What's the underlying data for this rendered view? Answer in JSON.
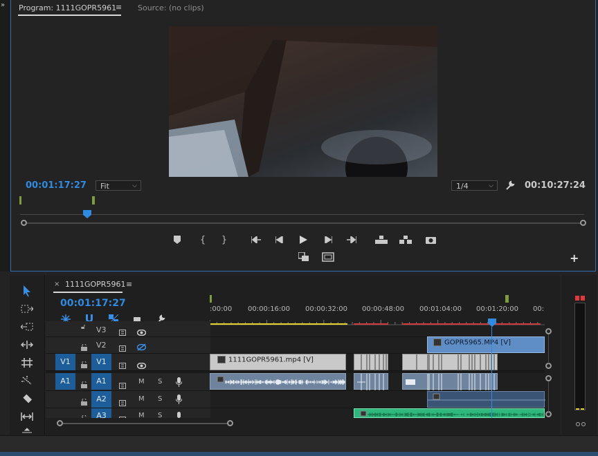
{
  "monitor": {
    "tabs": [
      {
        "label": "Program: 1111GOPR5961",
        "active": true
      },
      {
        "label": "Source: (no clips)",
        "active": false
      }
    ],
    "menu_icon": "≡",
    "current_time": "00:01:17:27",
    "fit_label": "Fit",
    "resolution_label": "1/4",
    "duration": "00:10:27:24",
    "playhead_fraction": 0.119,
    "controls": [
      "add-marker",
      "mark-in",
      "mark-out",
      "go-to-in",
      "step-back",
      "play",
      "step-forward",
      "go-to-out",
      "lift",
      "extract",
      "export-frame"
    ],
    "secondary_controls": [
      "insert-overwrite",
      "safe-margins"
    ],
    "add_button": "+"
  },
  "timeline": {
    "sequence_name": "1111GOPR5961",
    "close": "×",
    "menu_icon": "≡",
    "current_time": "00:01:17:27",
    "ruler_labels": [
      ":00:00",
      "00:00:16:00",
      "00:00:32:00",
      "00:00:48:00",
      "00:01:04:00",
      "00:01:20:00",
      "00:"
    ],
    "tracks": [
      {
        "name": "V3",
        "source": "",
        "target": "V3",
        "kind": "video"
      },
      {
        "name": "V2",
        "source": "",
        "target": "V2",
        "kind": "video"
      },
      {
        "name": "V1",
        "source": "V1",
        "target": "V1",
        "kind": "video"
      },
      {
        "name": "A1",
        "source": "A1",
        "target": "A1",
        "kind": "audio",
        "mute": "M",
        "solo": "S"
      },
      {
        "name": "A2",
        "source": "",
        "target": "A2",
        "kind": "audio",
        "mute": "M",
        "solo": "S"
      },
      {
        "name": "A3",
        "source": "",
        "target": "A3",
        "kind": "audio",
        "mute": "M",
        "solo": "S"
      }
    ],
    "clips": {
      "v2": "GOPR5965.MP4 [V]",
      "v1": "1111GOPR5961.mp4 [V]"
    }
  },
  "colors": {
    "accent_blue": "#2f8ae0",
    "patch_blue": "#1d5d99",
    "selected_clip": "#5f8dc6",
    "audio_green": "#2eb87e",
    "render_red": "#d23b3b",
    "render_yellow": "#e6d22f",
    "marker_green": "#7f9d3e"
  }
}
